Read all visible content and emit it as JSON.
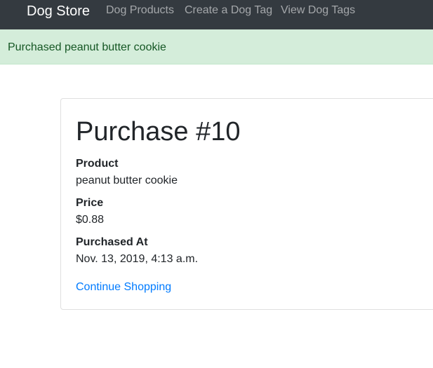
{
  "navbar": {
    "brand": "Dog Store",
    "links": [
      "Dog Products",
      "Create a Dog Tag",
      "View Dog Tags"
    ]
  },
  "alert": {
    "message": "Purchased peanut butter cookie"
  },
  "purchase": {
    "title": "Purchase #10",
    "fields": [
      {
        "label": "Product",
        "value": "peanut butter cookie"
      },
      {
        "label": "Price",
        "value": "$0.88"
      },
      {
        "label": "Purchased At",
        "value": "Nov. 13, 2019, 4:13 a.m."
      }
    ],
    "continue_link": "Continue Shopping"
  },
  "colors": {
    "navbar_bg": "#343a40",
    "alert_bg": "#d4edda",
    "alert_text": "#155724",
    "link": "#007bff"
  }
}
